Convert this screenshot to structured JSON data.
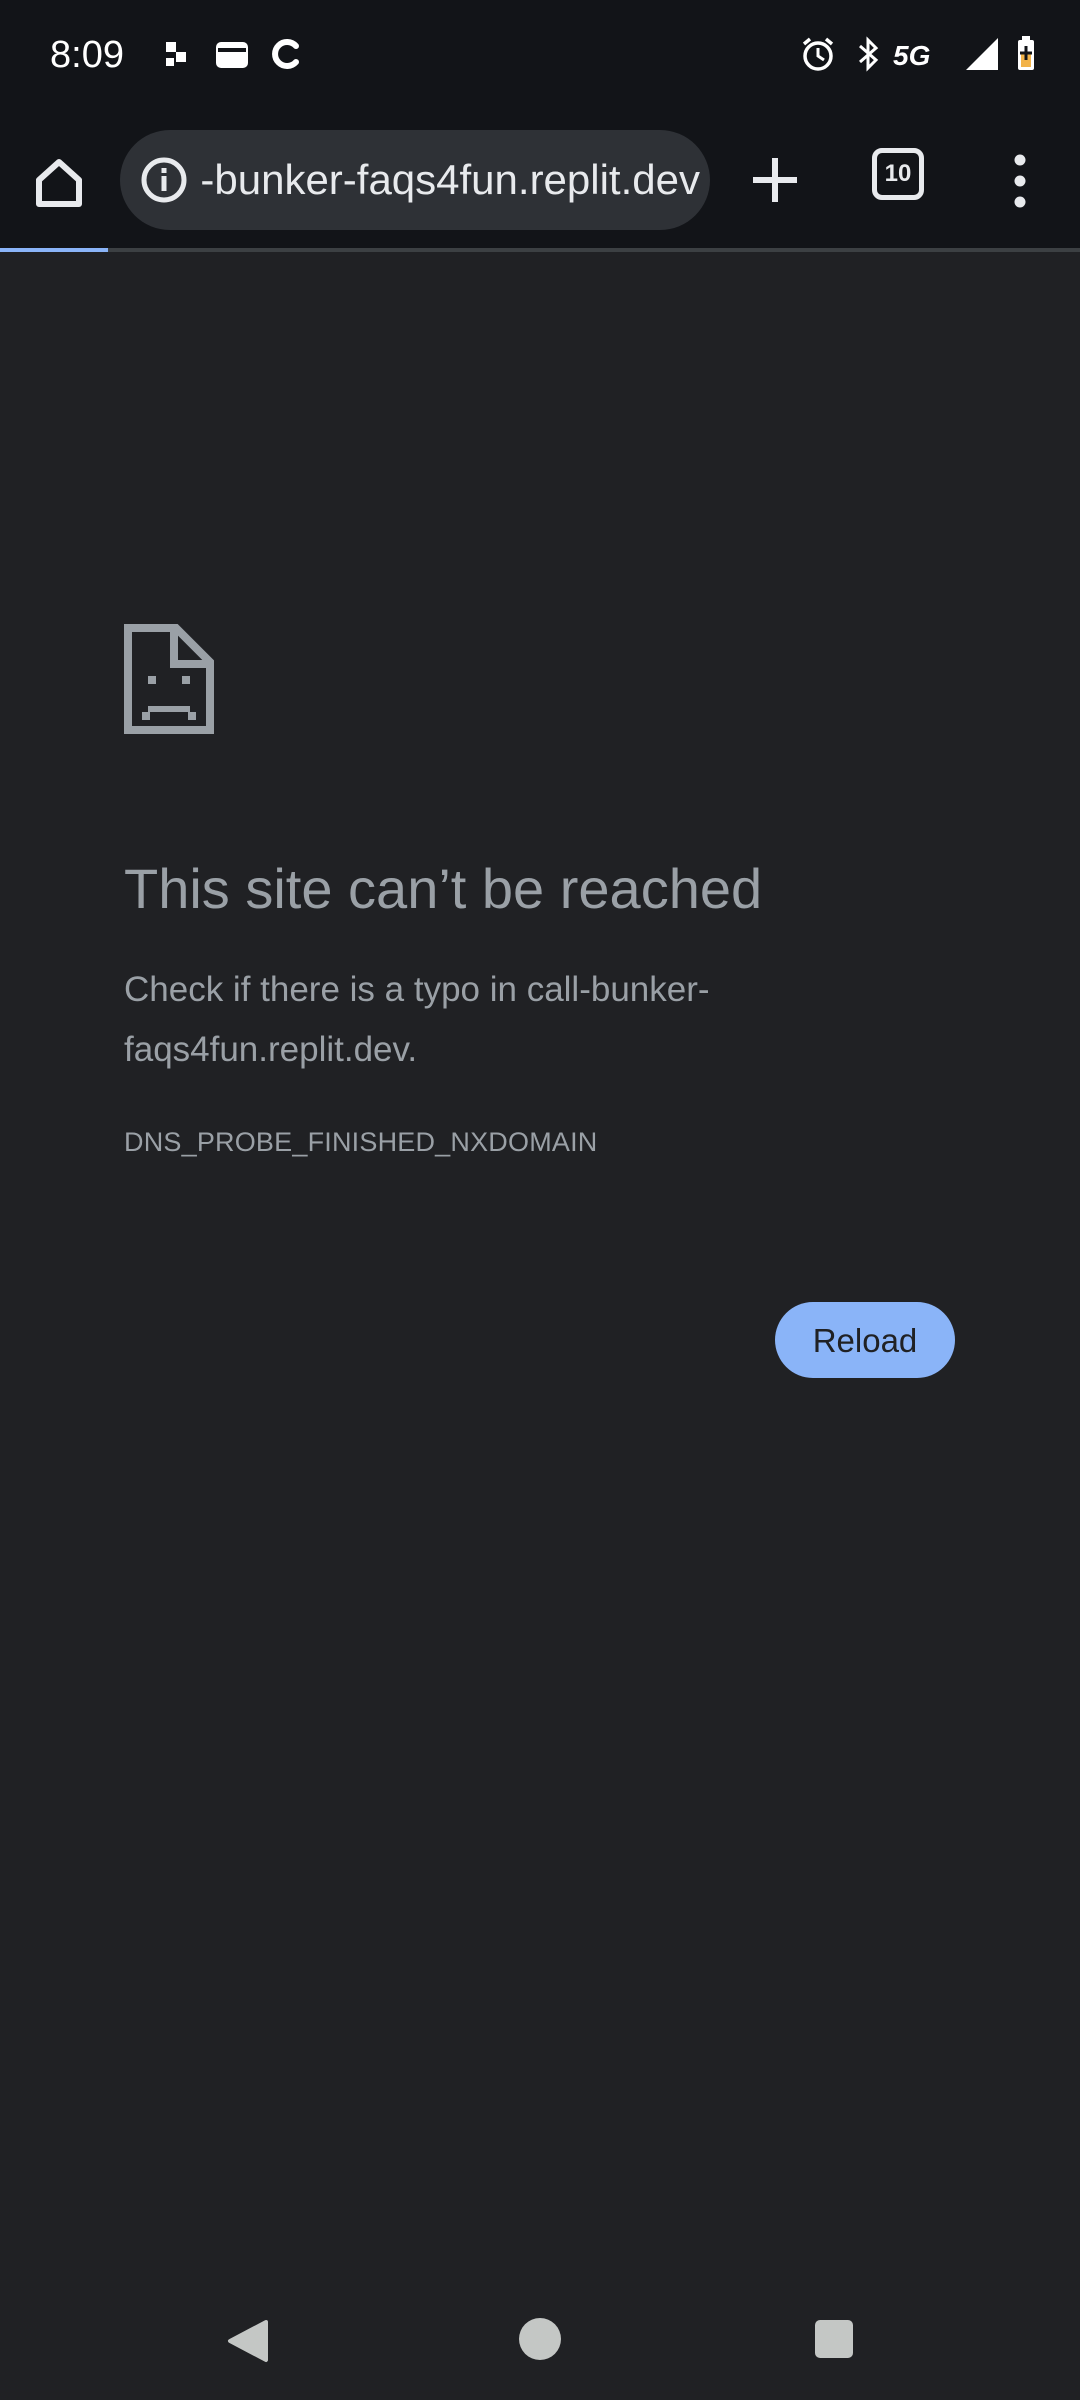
{
  "status_bar": {
    "time": "8:09",
    "left_icons": [
      "notification-dots-icon",
      "wallet-icon",
      "c-app-icon"
    ],
    "right_icons": [
      "alarm-icon",
      "bluetooth-icon",
      "signal-icon",
      "battery-icon"
    ],
    "network": "5G"
  },
  "toolbar": {
    "url": "call-bunker-faqs4fun.replit.dev",
    "tab_count": "10",
    "page_load_progress": 0.1
  },
  "error_page": {
    "title": "This site can’t be reached",
    "description": "Check if there is a typo in call-bunker-faqs4fun.replit.dev.",
    "code": "DNS_PROBE_FINISHED_NXDOMAIN",
    "reload_label": "Reload"
  },
  "colors": {
    "background": "#202124",
    "toolbar": "#121418",
    "accent": "#8ab4f8",
    "text_secondary": "#9aa0a6"
  }
}
